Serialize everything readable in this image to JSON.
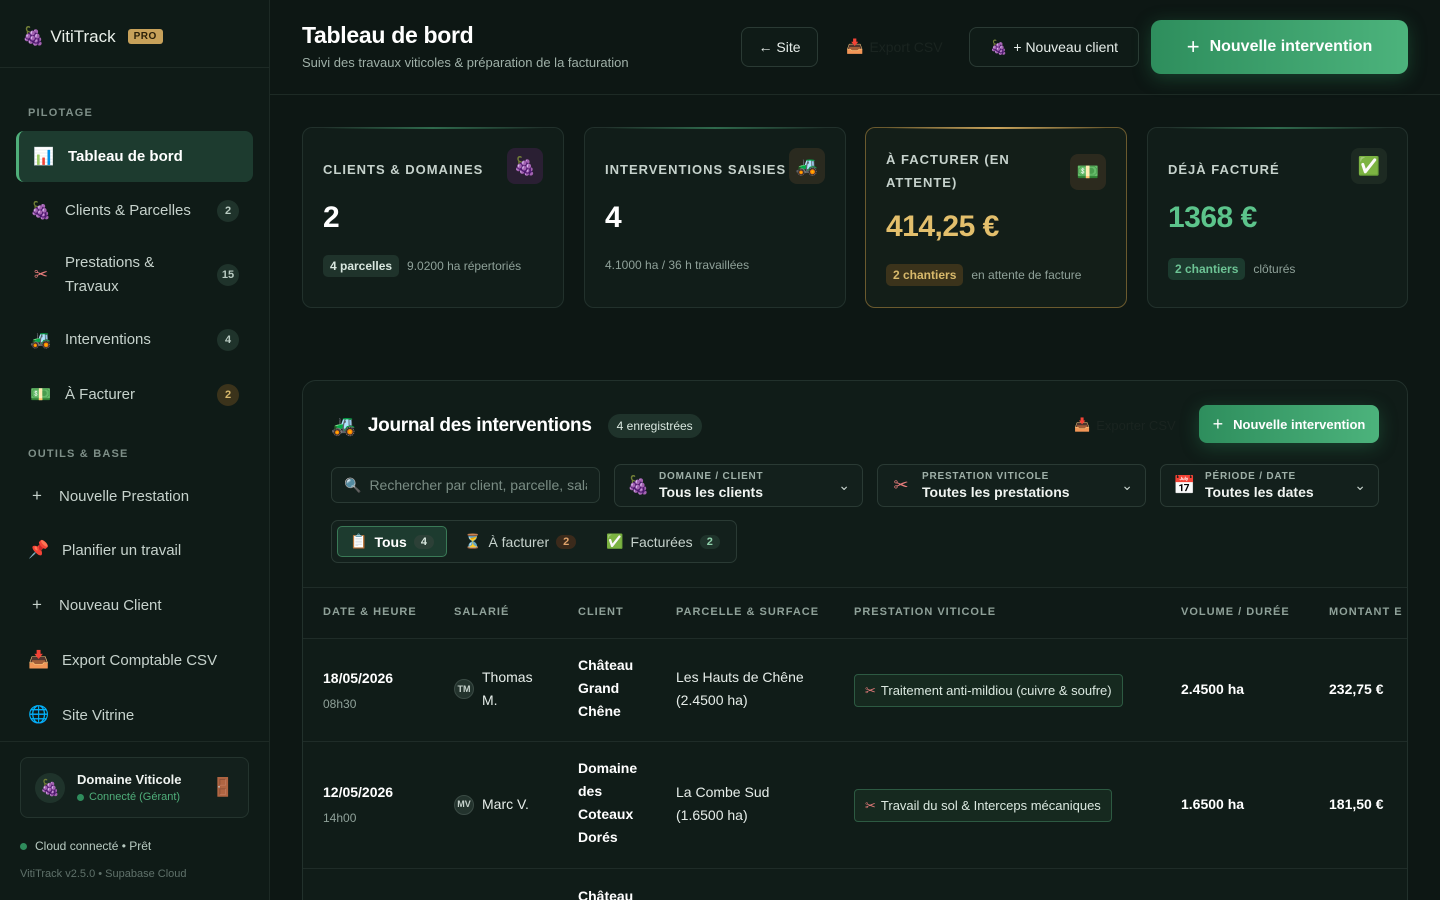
{
  "brand": {
    "name": "VitiTrack",
    "badge": "PRO"
  },
  "sidebar": {
    "section_pilotage": "PILOTAGE",
    "items": [
      {
        "label": "Tableau de bord",
        "icon": "chart-icon"
      },
      {
        "label": "Clients & Parcelles",
        "count": "2"
      },
      {
        "label": "Prestations &",
        "label2": "Travaux",
        "count": "15"
      },
      {
        "label": "Interventions",
        "count": "4"
      },
      {
        "label": "À Facturer",
        "count": "2"
      }
    ],
    "section_tools": "OUTILS & BASE",
    "tools": [
      {
        "label": "Nouvelle Prestation"
      },
      {
        "label": "Planifier un travail"
      },
      {
        "label": "Nouveau Client"
      },
      {
        "label": "Export Comptable CSV"
      },
      {
        "label": "Site Vitrine"
      }
    ],
    "account": {
      "name": "Domaine Viticole",
      "status": "Connecté (Gérant)"
    },
    "cloud": "Cloud connecté • Prêt",
    "version": "VitiTrack v2.5.0 • Supabase Cloud"
  },
  "header": {
    "title": "Tableau de bord",
    "subtitle": "Suivi des travaux viticoles & préparation de la facturation",
    "site_button": "← Site",
    "export_button": "Export CSV",
    "new_client_button": "+ Nouveau client",
    "new_intervention_button": "Nouvelle intervention"
  },
  "kpis": [
    {
      "title": "CLIENTS & DOMAINES",
      "value": "2",
      "pill": "4 parcelles",
      "foot": "9.0200 ha répertoriés"
    },
    {
      "title": "INTERVENTIONS SAISIES",
      "value": "4",
      "foot": "4.1000 ha / 36 h travaillées"
    },
    {
      "title": "À FACTURER (EN ATTENTE)",
      "value": "414,25 €",
      "pill": "2 chantiers",
      "foot": "en attente de facture"
    },
    {
      "title": "DÉJÀ FACTURÉ",
      "value": "1368 €",
      "pill": "2 chantiers",
      "foot": "clôturés"
    }
  ],
  "journal": {
    "title": "Journal des interventions",
    "badge": "4 enregistrées",
    "export": "Exporter CSV",
    "new_button": "Nouvelle intervention",
    "search_placeholder": "Rechercher par client, parcelle, salarié...",
    "filters": [
      {
        "label": "DOMAINE / CLIENT",
        "value": "Tous les clients"
      },
      {
        "label": "PRESTATION VITICOLE",
        "value": "Toutes les prestations"
      },
      {
        "label": "PÉRIODE / DATE",
        "value": "Toutes les dates"
      }
    ],
    "tabs": [
      {
        "label": "Tous",
        "count": "4"
      },
      {
        "label": "À facturer",
        "count": "2"
      },
      {
        "label": "Facturées",
        "count": "2"
      }
    ],
    "columns": [
      "DATE & HEURE",
      "SALARIÉ",
      "CLIENT",
      "PARCELLE & SURFACE",
      "PRESTATION VITICOLE",
      "VOLUME / DURÉE",
      "MONTANT E"
    ],
    "rows": [
      {
        "date": "18/05/2026",
        "time": "08h30",
        "initials": "TM",
        "employee1": "Thomas",
        "employee2": "M.",
        "client": [
          "Château",
          "Grand",
          "Chêne"
        ],
        "parcel1": "Les Hauts de Chêne",
        "parcel2": "(2.4500 ha)",
        "service": "Traitement anti-mildiou (cuivre & soufre)",
        "volume": "2.4500 ha",
        "amount": "232,75 €"
      },
      {
        "date": "12/05/2026",
        "time": "14h00",
        "initials": "MV",
        "employee1": "Marc V.",
        "employee2": "",
        "client": [
          "Domaine",
          "des",
          "Coteaux",
          "Dorés"
        ],
        "parcel1": "La Combe Sud",
        "parcel2": "(1.6500 ha)",
        "service": "Travail du sol & Interceps mécaniques",
        "volume": "1.6500 ha",
        "amount": "181,50 €"
      },
      {
        "client": [
          "Château"
        ]
      }
    ]
  },
  "colors": {
    "accent": "#4cb37c",
    "amber": "#e3bf6c",
    "background": "#0d1714"
  }
}
